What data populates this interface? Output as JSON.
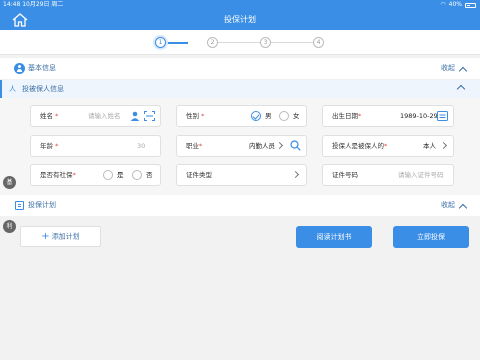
{
  "status_bar": {
    "time_date": "14:48  10月29日 周二",
    "battery": "40%"
  },
  "nav": {
    "title": "投保计划",
    "home_icon": "home-icon"
  },
  "steps": [
    "1",
    "2",
    "3",
    "4"
  ],
  "basic_section": {
    "label": "基本信息",
    "collapse": "收起"
  },
  "insured_section": {
    "label": "投被保人信息",
    "glyph": "人"
  },
  "fields": {
    "name": {
      "label": "姓名",
      "required": "*",
      "placeholder": "请输入姓名"
    },
    "gender": {
      "label": "性别",
      "required": "*",
      "options": [
        "男",
        "女"
      ],
      "selected": "男"
    },
    "birth": {
      "label": "出生日期",
      "required": "*",
      "value": "1989-10-29"
    },
    "age": {
      "label": "年龄",
      "required": "*",
      "value": "30"
    },
    "occupation": {
      "label": "职业",
      "required": "*",
      "value": "内勤人员"
    },
    "relation": {
      "label": "投保人是被保人的",
      "required": "*",
      "value": "本人"
    },
    "social": {
      "label": "是否有社保",
      "required": "*",
      "options": [
        "是",
        "否"
      ]
    },
    "id_type": {
      "label": "证件类型"
    },
    "id_no": {
      "label": "证件号码",
      "placeholder": "请输入证件号码"
    }
  },
  "side_badges": [
    "基",
    "险",
    "利"
  ],
  "plan_section": {
    "label": "投保计划",
    "collapse": "收起"
  },
  "actions": {
    "add_plan": "添加计划",
    "read_plan": "阅读计划书",
    "insure_now": "立即投保"
  },
  "colors": {
    "primary": "#3a8ee6",
    "text_accent": "#3a6ea5",
    "required": "#e64545"
  }
}
